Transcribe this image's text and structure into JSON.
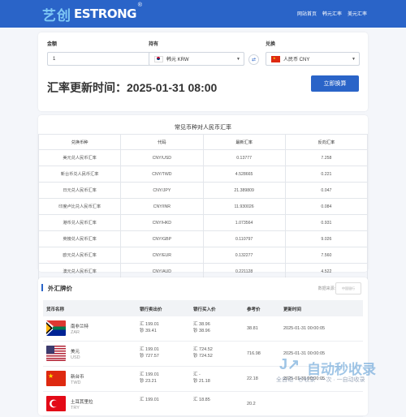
{
  "header": {
    "logo_cn": "艺创",
    "logo_en": "ESTRONG",
    "logo_reg": "®",
    "nav": [
      "网站首页",
      "韩元汇率",
      "美元汇率"
    ]
  },
  "converter": {
    "amount_label": "金额",
    "amount_value": "1",
    "have_label": "持有",
    "have_value": "韩元 KRW",
    "exchange_label": "兑换",
    "exchange_value": "人民币 CNY",
    "swap_icon": "⇄",
    "update_text": "汇率更新时间：2025-01-31  08:00",
    "button": "立即换算"
  },
  "rate_table": {
    "title": "常见币种对人民币汇率",
    "headers": [
      "兑换币种",
      "代码",
      "最新汇率",
      "反向汇率"
    ],
    "rows": [
      [
        "美元兑人民币汇率",
        "CNY/USD",
        "0.13777",
        "7.258"
      ],
      [
        "新台币兑人民币汇率",
        "CNY/TWD",
        "4.528665",
        "0.221"
      ],
      [
        "日元兑人民币汇率",
        "CNY/JPY",
        "21.389809",
        "0.047"
      ],
      [
        "印度卢比兑人民币汇率",
        "CNY/INR",
        "11.930026",
        "0.084"
      ],
      [
        "港币兑人民币汇率",
        "CNY/HKD",
        "1.073564",
        "0.931"
      ],
      [
        "英镑兑人民币汇率",
        "CNY/GBP",
        "0.110797",
        "9.026"
      ],
      [
        "欧元兑人民币汇率",
        "CNY/EUR",
        "0.132277",
        "7.560"
      ],
      [
        "澳元兑人民币汇率",
        "CNY/AUD",
        "0.221128",
        "4.522"
      ]
    ]
  },
  "fx": {
    "title": "外汇牌价",
    "source_label": "数据来源:",
    "bank_logo_text": "中国银行",
    "headers": [
      "货币名称",
      "银行卖出价",
      "银行买入价",
      "参考价",
      "更新时间"
    ],
    "rows": [
      {
        "name": "南非兰特",
        "code": "ZAR",
        "sell_1": "汇 199.01",
        "sell_2": "钞 39.41",
        "buy_1": "汇 38.96",
        "buy_2": "钞 38.96",
        "ref": "38.81",
        "time": "2025-01-31 00:00:05",
        "flag": "za"
      },
      {
        "name": "美元",
        "code": "USD",
        "sell_1": "汇 199.01",
        "sell_2": "钞 727.57",
        "buy_1": "汇 724.52",
        "buy_2": "钞 724.52",
        "ref": "716.98",
        "time": "2025-01-31 00:00:05",
        "flag": "us"
      },
      {
        "name": "新台币",
        "code": "TWD",
        "sell_1": "汇 199.01",
        "sell_2": "钞 23.21",
        "buy_1": "汇 -",
        "buy_2": "钞 21.18",
        "ref": "22.18",
        "time": "2025-01-31 00:00:05",
        "flag": "tw"
      },
      {
        "name": "土耳其里拉",
        "code": "TRY",
        "sell_1": "汇 199.01",
        "sell_2": "",
        "buy_1": "汇 18.85",
        "buy_2": "",
        "ref": "20.2",
        "time": "",
        "flag": "tr"
      }
    ]
  },
  "watermark": {
    "main": "自动秒收录",
    "sub": "全自动 · 秒收录 · 一次 · 一自动收录"
  },
  "colors": {
    "brand": "#2a64c8",
    "page_bg": "#f4f6fa"
  }
}
